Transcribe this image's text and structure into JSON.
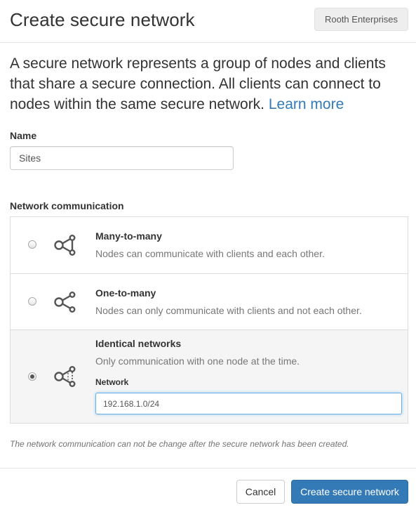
{
  "header": {
    "title": "Create secure network",
    "organization": "Rooth Enterprises"
  },
  "intro": {
    "text": "A secure network represents a group of nodes and clients that share a secure connection. All clients can connect to nodes within the same secure network.",
    "learn_more": "Learn more"
  },
  "name": {
    "label": "Name",
    "value": "Sites"
  },
  "communication": {
    "label": "Network communication",
    "options": [
      {
        "title": "Many-to-many",
        "description": "Nodes can communicate with clients and each other.",
        "selected": false,
        "icon": "many-to-many-icon"
      },
      {
        "title": "One-to-many",
        "description": "Nodes can only communicate with clients and not each other.",
        "selected": false,
        "icon": "one-to-many-icon"
      },
      {
        "title": "Identical networks",
        "description": "Only communication with one node at the time.",
        "selected": true,
        "icon": "identical-networks-icon",
        "network_label": "Network",
        "network_value": "192.168.1.0/24"
      }
    ],
    "help": "The network communication can not be change after the secure network has been created."
  },
  "footer": {
    "cancel_label": "Cancel",
    "submit_label": "Create secure network"
  },
  "colors": {
    "primary": "#337ab7",
    "selected_row": "#f5f5f5",
    "muted_text": "#777777"
  }
}
